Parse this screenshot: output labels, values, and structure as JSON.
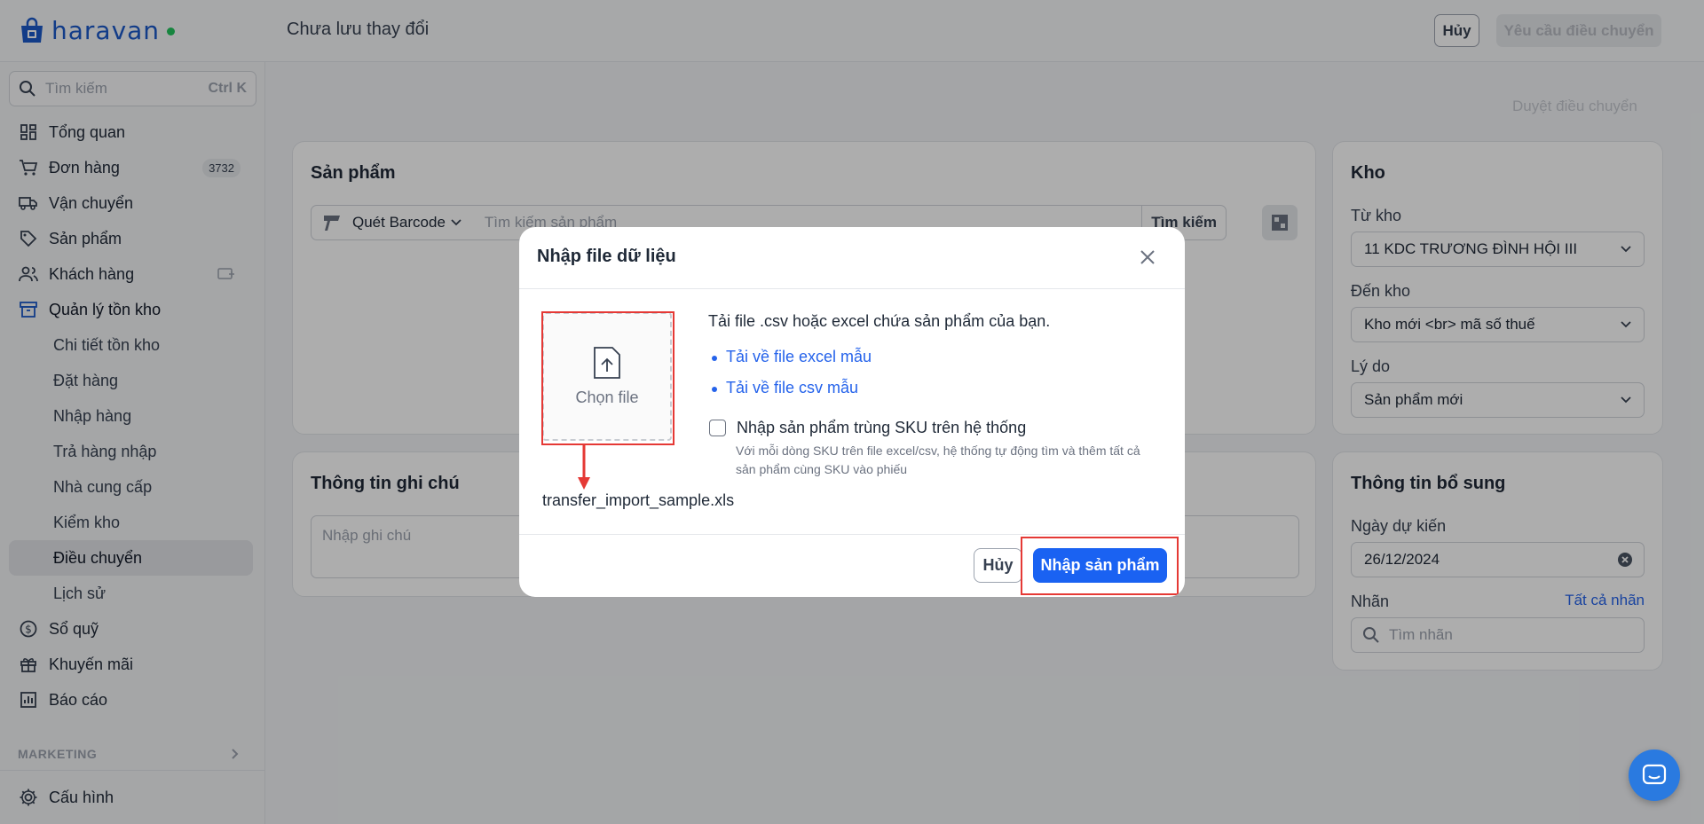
{
  "brand": {
    "name": "haravan"
  },
  "header": {
    "title": "Chưa lưu thay đổi",
    "cancel_label": "Hủy",
    "request_label": "Yêu cầu điều chuyển"
  },
  "sidebar": {
    "search_placeholder": "Tìm kiếm",
    "search_shortcut": "Ctrl K",
    "items": [
      {
        "label": "Tổng quan",
        "icon": "dashboard-icon"
      },
      {
        "label": "Đơn hàng",
        "icon": "cart-icon",
        "badge": "3732"
      },
      {
        "label": "Vận chuyển",
        "icon": "truck-icon"
      },
      {
        "label": "Sản phẩm",
        "icon": "tag-icon"
      },
      {
        "label": "Khách hàng",
        "icon": "users-icon"
      },
      {
        "label": "Quản lý tồn kho",
        "icon": "archive-icon"
      }
    ],
    "sub_items": [
      {
        "label": "Chi tiết tồn kho"
      },
      {
        "label": "Đặt hàng"
      },
      {
        "label": "Nhập hàng"
      },
      {
        "label": "Trả hàng nhập"
      },
      {
        "label": "Nhà cung cấp"
      },
      {
        "label": "Kiểm kho"
      },
      {
        "label": "Điều chuyển",
        "active": true
      },
      {
        "label": "Lịch sử"
      }
    ],
    "bottom_items": [
      {
        "label": "Sổ quỹ",
        "icon": "dollar-icon"
      },
      {
        "label": "Khuyến mãi",
        "icon": "gift-icon"
      },
      {
        "label": "Báo cáo",
        "icon": "chart-icon"
      }
    ],
    "marketing_label": "MARKETING",
    "settings_label": "Cấu hình"
  },
  "main": {
    "approve_link": "Duyệt điều chuyển",
    "products": {
      "title": "Sản phẩm",
      "scan_label": "Quét Barcode",
      "search_placeholder": "Tìm kiếm sản phẩm",
      "search_button": "Tìm kiếm"
    },
    "notes": {
      "title": "Thông tin ghi chú",
      "placeholder": "Nhập ghi chú"
    },
    "warehouse": {
      "title": "Kho",
      "from_label": "Từ kho",
      "from_value": "11 KDC TRƯƠNG ĐÌNH HỘI III",
      "to_label": "Đến kho",
      "to_value": "Kho mới <br> mã số thuế",
      "reason_label": "Lý do",
      "reason_value": "Sản phẩm mới"
    },
    "extra": {
      "title": "Thông tin bổ sung",
      "date_label": "Ngày dự kiến",
      "date_value": "26/12/2024",
      "tags_label": "Nhãn",
      "tags_link": "Tất cả nhãn",
      "tags_placeholder": "Tìm nhãn"
    }
  },
  "modal": {
    "title": "Nhập file dữ liệu",
    "upload_label": "Chọn file",
    "selected_file": "transfer_import_sample.xls",
    "description": "Tải file .csv hoặc excel chứa sản phẩm của bạn.",
    "links": [
      "Tải về file excel mẫu",
      "Tải về file csv mẫu"
    ],
    "checkbox_label": "Nhập sản phẩm trùng SKU trên hệ thống",
    "checkbox_checked": false,
    "checkbox_help": "Với mỗi dòng SKU trên file excel/csv, hệ thống tự động tìm và thêm tất cả sản phẩm cùng SKU vào phiếu",
    "cancel_label": "Hủy",
    "submit_label": "Nhập sản phẩm"
  },
  "colors": {
    "primary": "#1a62f2",
    "brand": "#1b59c9",
    "annotation": "#e53935",
    "online": "#22c55e"
  }
}
